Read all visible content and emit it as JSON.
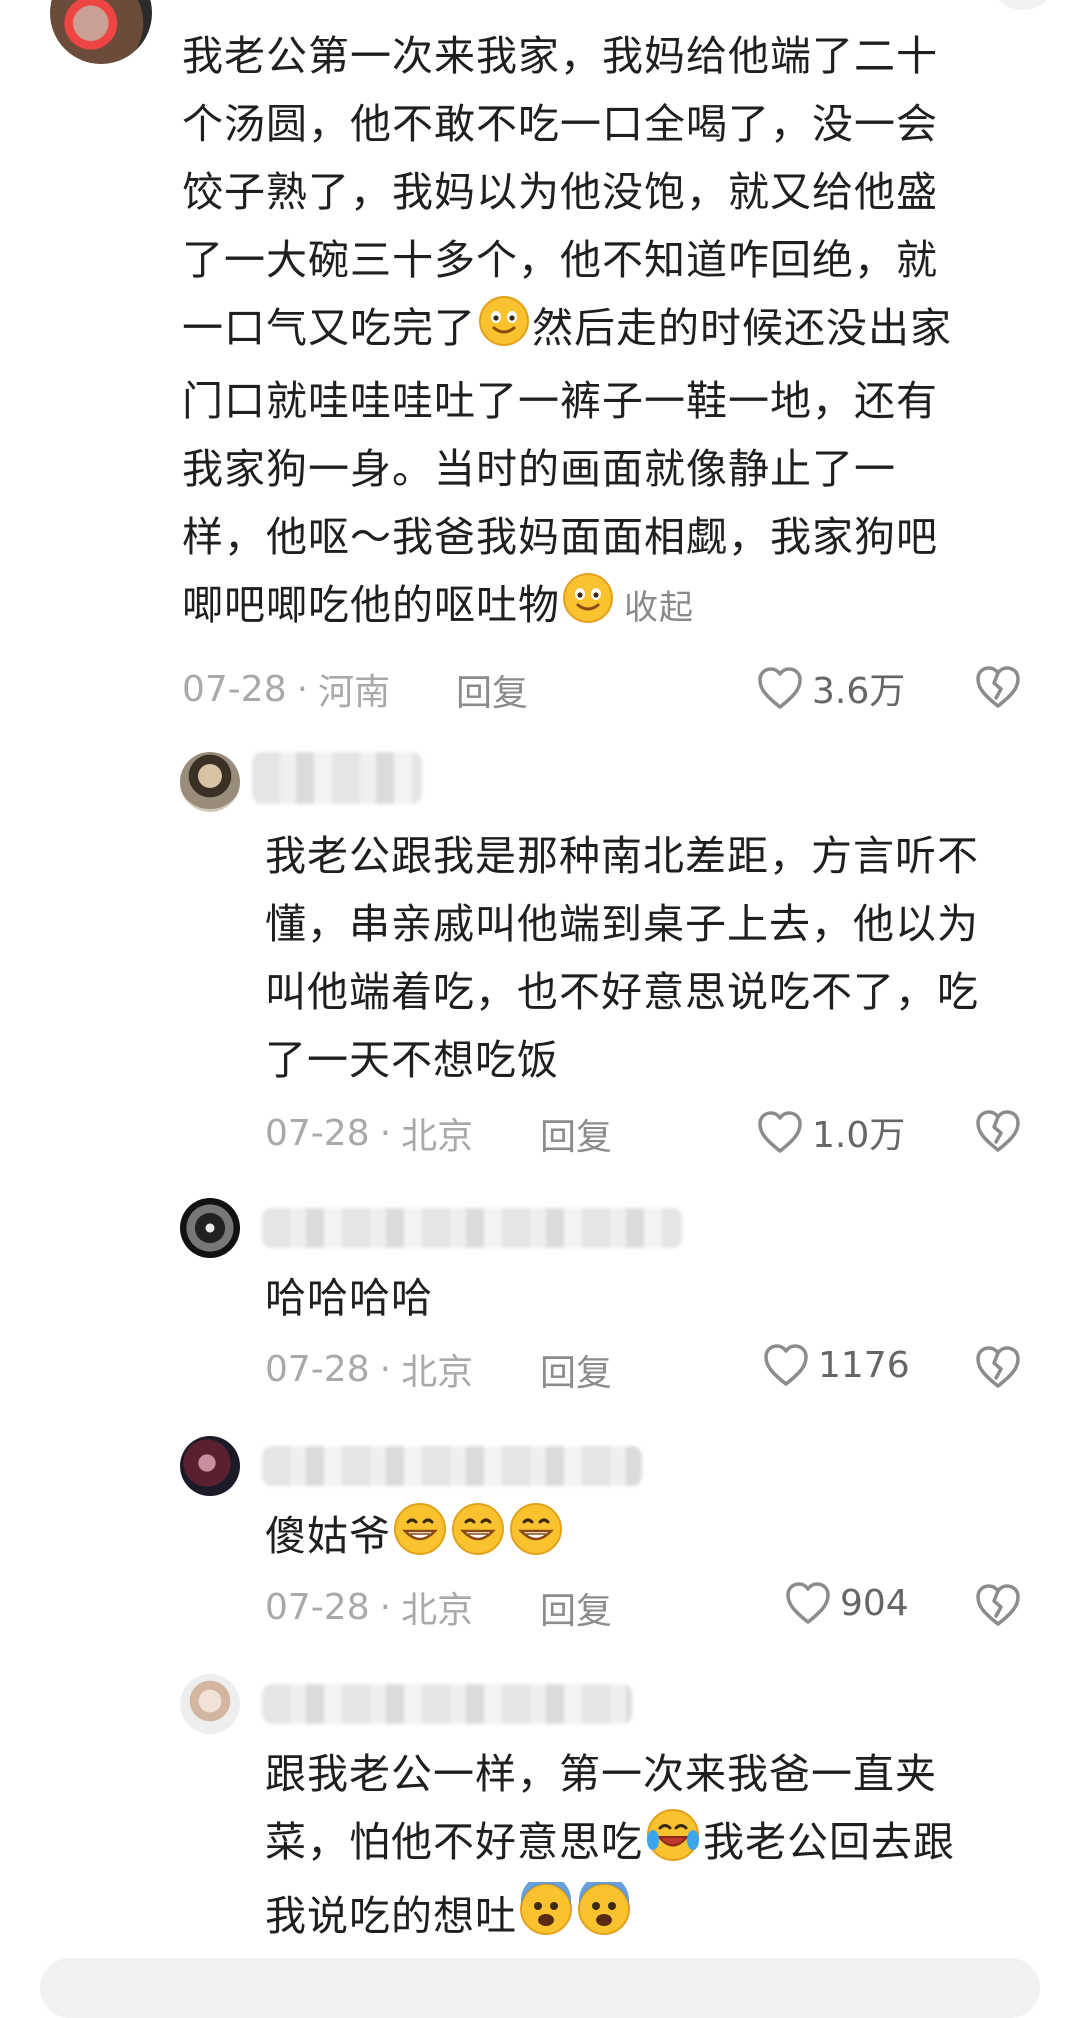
{
  "main_comment": {
    "lines": [
      "我老公第一次来我家，我妈给他端了二十",
      "个汤圆，他不敢不吃一口全喝了，没一会",
      "饺子熟了，我妈以为他没饱，就又给他盛",
      "了一大碗三十多个，他不知道咋回绝，就",
      "一口气又吃完了",
      "然后走的时候还没出家",
      "门口就哇哇哇吐了一裤子一鞋一地，还有",
      "我家狗一身。当时的画面就像静止了一",
      "样，他呕～我爸我妈面面相觑，我家狗吧",
      "唧吧唧吃他的呕吐物"
    ],
    "collapse_label": "收起",
    "date": "07-28",
    "location": "河南",
    "reply_label": "回复",
    "likes": "3.6万"
  },
  "replies": [
    {
      "text_lines": [
        "我老公跟我是那种南北差距，方言听不",
        "懂，串亲戚叫他端到桌子上去，他以为",
        "叫他端着吃，也不好意思说吃不了，吃",
        "了一天不想吃饭"
      ],
      "date": "07-28",
      "location": "北京",
      "reply_label": "回复",
      "likes": "1.0万"
    },
    {
      "text_lines": [
        "哈哈哈哈"
      ],
      "date": "07-28",
      "location": "北京",
      "reply_label": "回复",
      "likes": "1176"
    },
    {
      "text": "傻姑爷",
      "date": "07-28",
      "location": "北京",
      "reply_label": "回复",
      "likes": "904"
    },
    {
      "text_lines": [
        "跟我老公一样，第一次来我爸一直夹",
        "菜，怕他不好意思吃",
        "我老公回去跟",
        "我说吃的想吐"
      ]
    }
  ],
  "meta_separator": "·",
  "icons": {
    "emoji_smile": "smiling-face-icon",
    "emoji_grin": "grinning-face-icon",
    "emoji_cry_laugh": "crying-laughing-face-icon",
    "emoji_fearful": "fearful-face-icon",
    "like": "heart-outline-icon",
    "dislike": "broken-heart-icon"
  },
  "colors": {
    "text": "#1f1f1f",
    "meta": "#a9a9a9",
    "icon": "#8c8c8c"
  }
}
